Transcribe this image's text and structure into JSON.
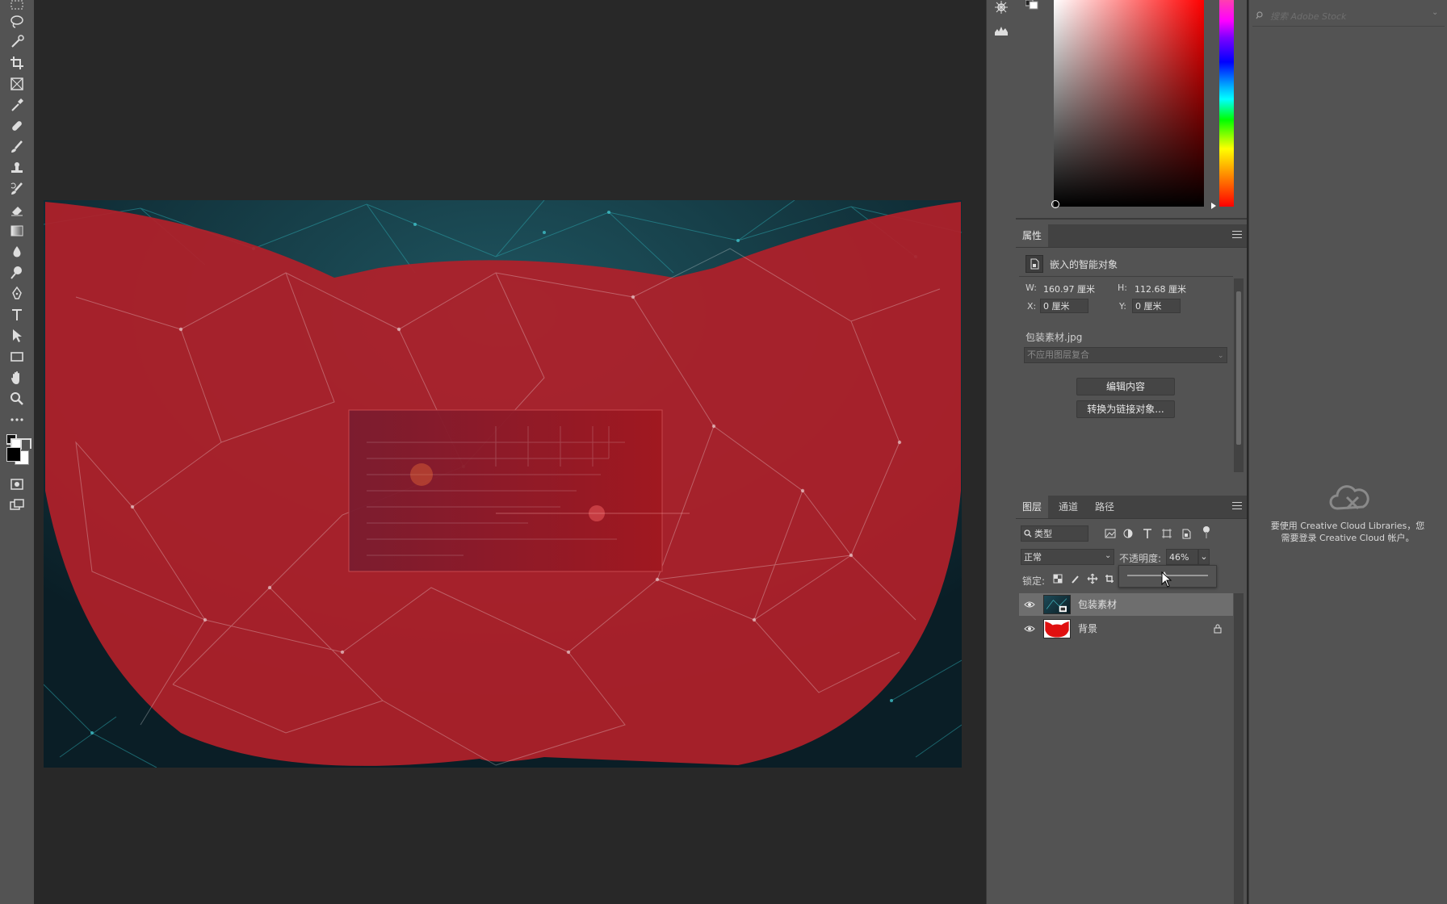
{
  "properties": {
    "tab": "属性",
    "object_type": "嵌入的智能对象",
    "w_label": "W:",
    "w_value": "160.97 厘米",
    "h_label": "H:",
    "h_value": "112.68 厘米",
    "x_label": "X:",
    "x_value": "0 厘米",
    "y_label": "Y:",
    "y_value": "0 厘米",
    "filename": "包装素材.jpg",
    "comp_placeholder": "不应用图层复合",
    "edit_button": "编辑内容",
    "convert_button": "转换为链接对象..."
  },
  "layers_panel": {
    "tabs": [
      "图层",
      "通道",
      "路径"
    ],
    "filter_kind": "类型",
    "blend_mode": "正常",
    "opacity_label": "不透明度:",
    "opacity_value": "46%",
    "opacity_fraction": 0.46,
    "lock_label": "锁定:",
    "layers": [
      {
        "name": "包装素材",
        "visible": true,
        "selected": true,
        "locked": false
      },
      {
        "name": "背景",
        "visible": true,
        "selected": false,
        "locked": true
      }
    ]
  },
  "libraries": {
    "search_placeholder": "搜索 Adobe Stock",
    "message": "要使用 Creative Cloud Libraries，您需要登录 Creative Cloud 帐户。"
  },
  "colors": {
    "ui_bg": "#535353",
    "canvas_bg": "#282828",
    "overlay_red": "#b0202a",
    "network_teal": "#1a8a95"
  },
  "toolbar_icons": [
    "marquee-icon",
    "lasso-icon",
    "quick-select-icon",
    "crop-icon",
    "frame-icon",
    "eyedropper-icon",
    "healing-icon",
    "brush-icon",
    "stamp-icon",
    "history-brush-icon",
    "eraser-icon",
    "gradient-icon",
    "blur-icon",
    "dodge-icon",
    "pen-icon",
    "type-icon",
    "path-select-icon",
    "rectangle-icon",
    "hand-icon",
    "zoom-icon",
    "more-icon"
  ]
}
